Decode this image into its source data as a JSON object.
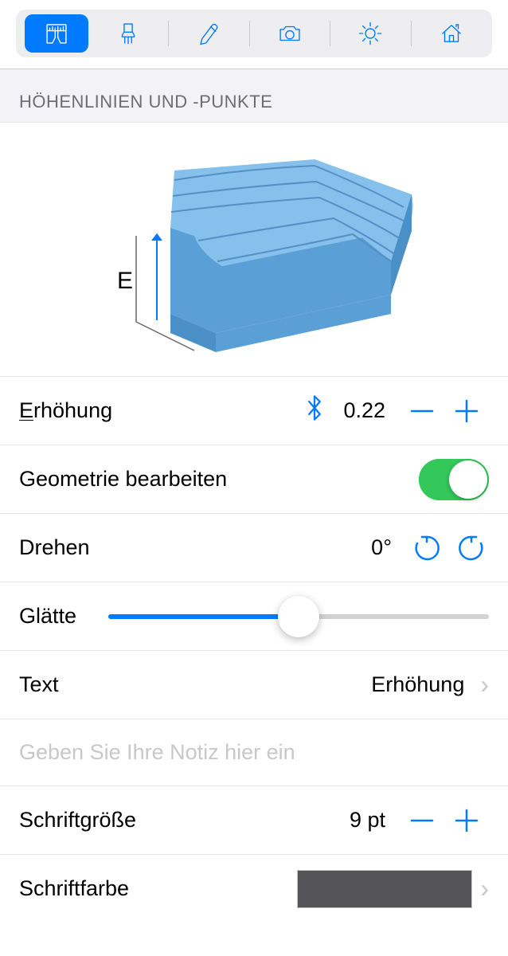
{
  "section_title": "HÖHENLINIEN UND -PUNKTE",
  "illustration_label": "E",
  "rows": {
    "elevation": {
      "label_first": "E",
      "label_rest": "rhöhung",
      "value": "0.22"
    },
    "edit_geometry": {
      "label": "Geometrie bearbeiten"
    },
    "rotate": {
      "label": "Drehen",
      "value": "0°"
    },
    "smoothness": {
      "label": "Glätte",
      "percent": 50
    },
    "text": {
      "label": "Text",
      "value": "Erhöhung"
    },
    "note_placeholder": "Geben Sie Ihre Notiz hier ein",
    "font_size": {
      "label": "Schriftgröße",
      "value": "9 pt"
    },
    "font_color": {
      "label": "Schriftfarbe",
      "swatch": "#555557"
    }
  }
}
